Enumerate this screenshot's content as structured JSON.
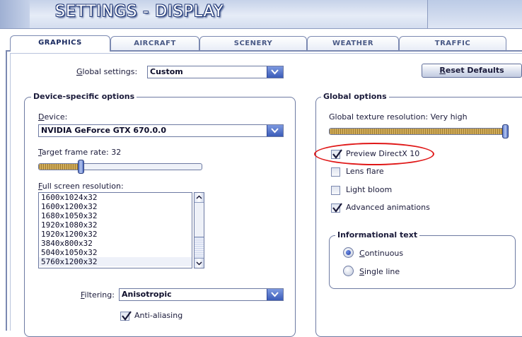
{
  "title": "SETTINGS - DISPLAY",
  "tabs": [
    {
      "label": "GRAPHICS",
      "active": true
    },
    {
      "label": "AIRCRAFT",
      "active": false
    },
    {
      "label": "SCENERY",
      "active": false
    },
    {
      "label": "WEATHER",
      "active": false
    },
    {
      "label": "TRAFFIC",
      "active": false
    }
  ],
  "global_settings": {
    "label_prefix": "",
    "label_underline": "G",
    "label_rest": "lobal settings:",
    "value": "Custom"
  },
  "reset_button": {
    "label_underline": "R",
    "label_rest": "eset Defaults"
  },
  "device_group": {
    "title": "Device-specific options",
    "device_label_underline": "D",
    "device_label_rest": "evice:",
    "device_value": "NVIDIA GeForce GTX 670.0.0",
    "frame_rate_label_underline": "T",
    "frame_rate_label_rest": "arget frame rate: 32",
    "frame_rate_fraction": 0.25,
    "resolution_label_underline": "F",
    "resolution_label_rest": "ull screen resolution:",
    "resolutions": [
      "1600x1024x32",
      "1600x1200x32",
      "1680x1050x32",
      "1920x1080x32",
      "1920x1200x32",
      "3840x800x32",
      "5040x1050x32",
      "5760x1200x32"
    ],
    "selected_resolution": "5760x1200x32",
    "filtering_label_prefix": "",
    "filtering_label_underline": "F",
    "filtering_label_rest": "iltering:",
    "filtering_value": "Anisotropic",
    "antialiasing_label": "Anti-aliasing",
    "antialiasing_checked": true
  },
  "global_group": {
    "title": "Global options",
    "texture_label": "Global texture resolution: Very high",
    "texture_fraction": 1.0,
    "options": [
      {
        "label": "Preview DirectX 10",
        "checked": true
      },
      {
        "label": "Lens flare",
        "checked": false
      },
      {
        "label": "Light bloom",
        "checked": false
      },
      {
        "label": "Advanced animations",
        "checked": true
      }
    ]
  },
  "info_group": {
    "title": "Informational text",
    "options": [
      {
        "label": "Continuous",
        "selected": true
      },
      {
        "label": "Single line",
        "selected": false
      }
    ]
  },
  "colors": {
    "accent_blue": "#3a5bb8",
    "annotation_red": "#e01818",
    "border": "#6d7aa2"
  }
}
